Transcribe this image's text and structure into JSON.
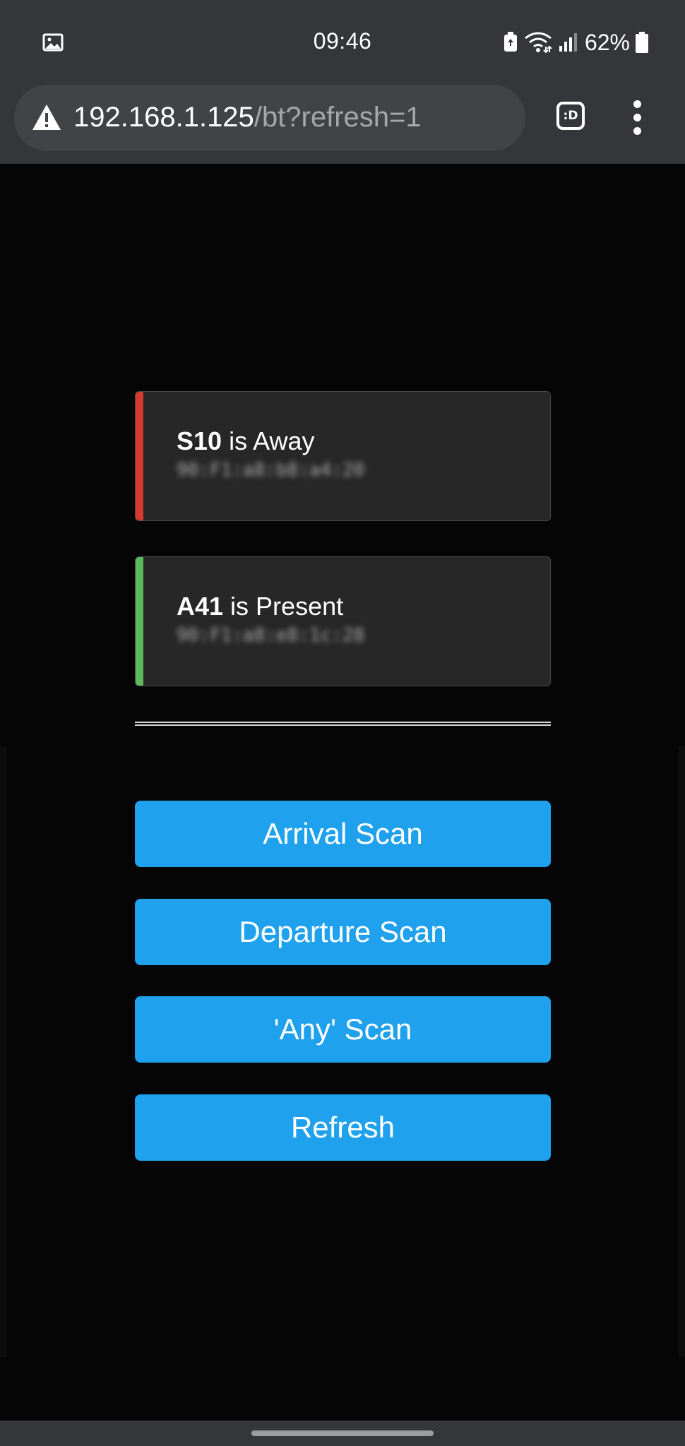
{
  "status_bar": {
    "time": "09:46",
    "battery_percent": "62%",
    "icons": [
      "gallery-icon",
      "battery-saver-icon",
      "wifi-icon",
      "signal-icon",
      "battery-icon"
    ]
  },
  "browser": {
    "url_host": "192.168.1.125",
    "url_path": "/bt?refresh=1",
    "tabs_label": ":D",
    "icons": [
      "warning-icon",
      "tab-switcher-icon",
      "more-menu-icon"
    ]
  },
  "devices": [
    {
      "name": "S10",
      "status_text": " is Away",
      "mac": "90:F1:a8:b8:a4:20",
      "status": "away",
      "accent_color": "#d63a2f"
    },
    {
      "name": "A41",
      "status_text": " is Present",
      "mac": "90:F1:a8:e8:1c:28",
      "status": "present",
      "accent_color": "#5cb85c"
    }
  ],
  "buttons": {
    "arrival": "Arrival Scan",
    "departure": "Departure Scan",
    "any": "'Any' Scan",
    "refresh": "Refresh"
  },
  "colors": {
    "button_bg": "#1fa1ed",
    "page_bg": "#050506",
    "card_bg": "#272728",
    "chrome_bg": "#35363a"
  }
}
